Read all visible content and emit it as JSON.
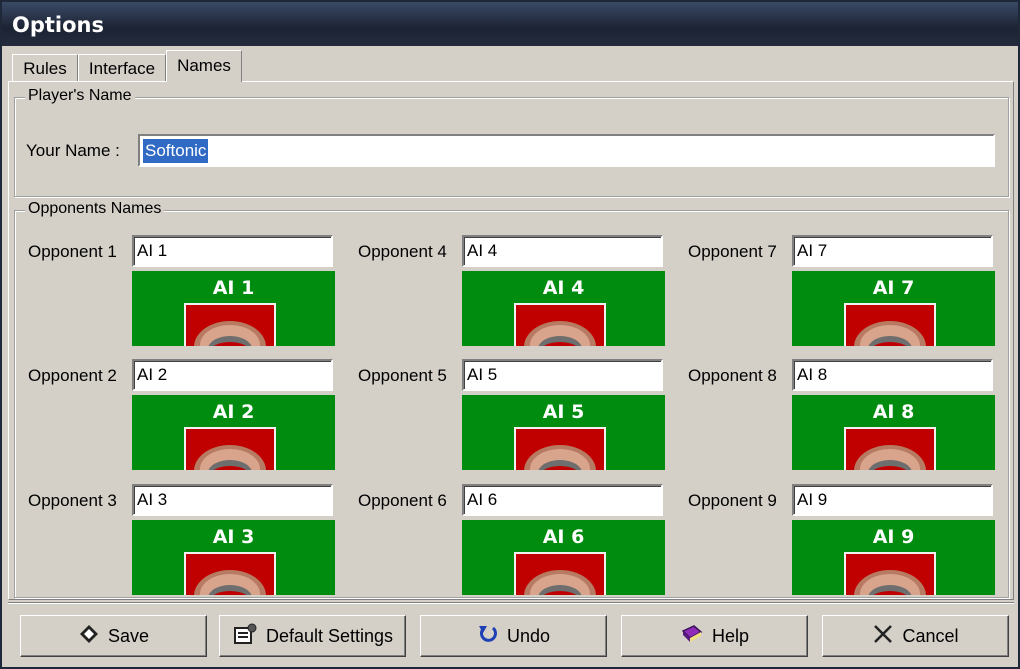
{
  "window": {
    "title": "Options"
  },
  "tabs": [
    {
      "label": "Rules",
      "active": false
    },
    {
      "label": "Interface",
      "active": false
    },
    {
      "label": "Names",
      "active": true
    }
  ],
  "player": {
    "group_label": "Player's Name",
    "name_label": "Your Name :",
    "name_value": "Softonic"
  },
  "opponents": {
    "group_label": "Opponents Names",
    "items": [
      {
        "label": "Opponent 1",
        "value": "AI 1",
        "avatar_name": "AI 1"
      },
      {
        "label": "Opponent 2",
        "value": "AI 2",
        "avatar_name": "AI 2"
      },
      {
        "label": "Opponent 3",
        "value": "AI 3",
        "avatar_name": "AI 3"
      },
      {
        "label": "Opponent 4",
        "value": "AI 4",
        "avatar_name": "AI 4"
      },
      {
        "label": "Opponent 5",
        "value": "AI 5",
        "avatar_name": "AI 5"
      },
      {
        "label": "Opponent 6",
        "value": "AI 6",
        "avatar_name": "AI 6"
      },
      {
        "label": "Opponent 7",
        "value": "AI 7",
        "avatar_name": "AI 7"
      },
      {
        "label": "Opponent 8",
        "value": "AI 8",
        "avatar_name": "AI 8"
      },
      {
        "label": "Opponent 9",
        "value": "AI 9",
        "avatar_name": "AI 9"
      }
    ]
  },
  "buttons": [
    {
      "label": "Save",
      "icon": "diskette-icon",
      "name": "save-button"
    },
    {
      "label": "Default Settings",
      "icon": "settings-icon",
      "name": "default-settings-button"
    },
    {
      "label": "Undo",
      "icon": "undo-icon",
      "name": "undo-button"
    },
    {
      "label": "Help",
      "icon": "help-book-icon",
      "name": "help-button"
    },
    {
      "label": "Cancel",
      "icon": "close-icon",
      "name": "cancel-button"
    }
  ],
  "colors": {
    "avatar_bg": "#008c0e",
    "avatar_picture_bg": "#c00000",
    "selection": "#316ac5"
  }
}
